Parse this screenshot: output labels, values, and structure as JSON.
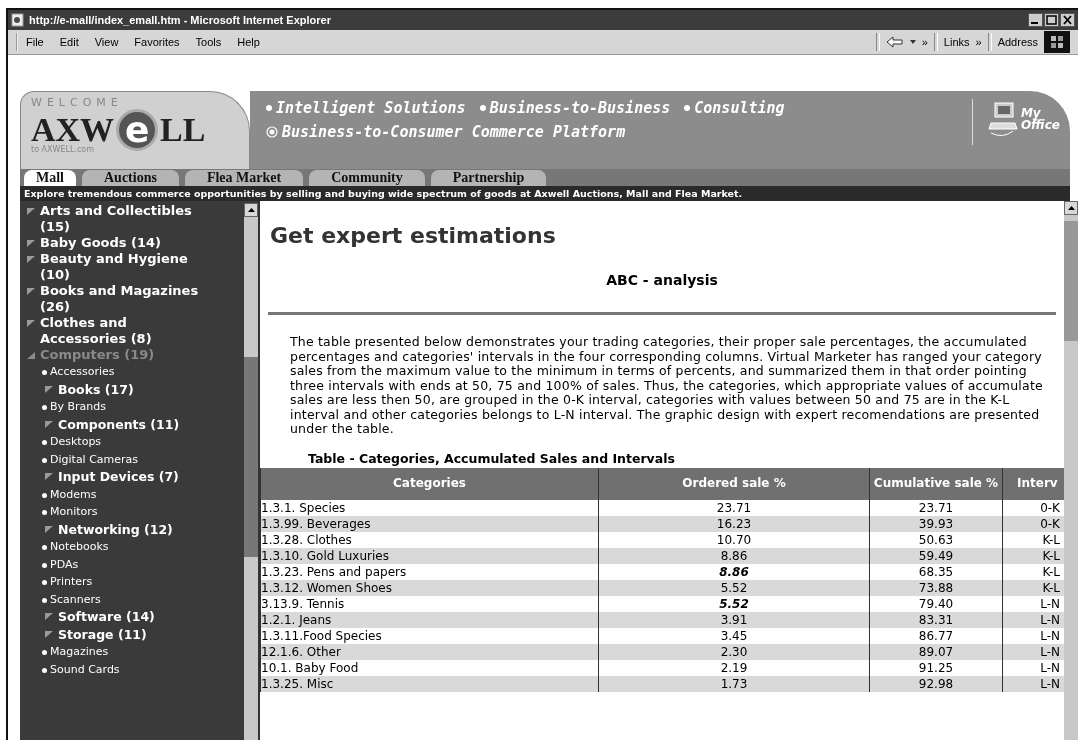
{
  "window": {
    "title": "http://e-mall/index_emall.htm - Microsoft Internet Explorer"
  },
  "menu": [
    "File",
    "Edit",
    "View",
    "Favorites",
    "Tools",
    "Help"
  ],
  "toolbar": {
    "more_1": "»",
    "links": "Links",
    "more_2": "»",
    "address": "Address"
  },
  "header": {
    "welcome": "WELCOME",
    "logo_left": "AXW",
    "logo_e": "e",
    "logo_right": "LL",
    "logo_sub": "to AXWELL.com",
    "taglines": [
      "Intelligent Solutions",
      "Business-to-Business",
      "Consulting"
    ],
    "platform": "Business-to-Consumer Commerce Platform",
    "office_1": "My",
    "office_2": "Office"
  },
  "tabs": [
    {
      "label": "Mall",
      "selected": true
    },
    {
      "label": "Auctions",
      "selected": false
    },
    {
      "label": "Flea Market",
      "selected": false
    },
    {
      "label": "Community",
      "selected": false
    },
    {
      "label": "Partnership",
      "selected": false
    }
  ],
  "banner": "Explore tremendous commerce opportunities by selling and buying wide spectrum of goods at Axwell Auctions, Mall and Flea Market.",
  "sidebar": {
    "items": [
      {
        "label": "Arts and Collectibles (15)",
        "kind": "category",
        "expanded": false
      },
      {
        "label": "Baby Goods (14)",
        "kind": "category",
        "expanded": false
      },
      {
        "label": "Beauty and Hygiene (10)",
        "kind": "category",
        "expanded": false
      },
      {
        "label": "Books and Magazines (26)",
        "kind": "category",
        "expanded": false
      },
      {
        "label": "Clothes and Accessories (8)",
        "kind": "category",
        "expanded": false
      },
      {
        "label": "Computers (19)",
        "kind": "category",
        "expanded": true,
        "children": [
          {
            "label": "Accessories",
            "kind": "link"
          },
          {
            "label": "Books (17)",
            "kind": "group"
          },
          {
            "label": "By Brands",
            "kind": "link"
          },
          {
            "label": "Components (11)",
            "kind": "group"
          },
          {
            "label": "Desktops",
            "kind": "link"
          },
          {
            "label": "Digital Cameras",
            "kind": "link"
          },
          {
            "label": "Input Devices (7)",
            "kind": "group"
          },
          {
            "label": "Modems",
            "kind": "link"
          },
          {
            "label": "Monitors",
            "kind": "link"
          },
          {
            "label": "Networking (12)",
            "kind": "group"
          },
          {
            "label": "Notebooks",
            "kind": "link"
          },
          {
            "label": "PDAs",
            "kind": "link"
          },
          {
            "label": "Printers",
            "kind": "link"
          },
          {
            "label": "Scanners",
            "kind": "link"
          },
          {
            "label": "Software (14)",
            "kind": "group"
          },
          {
            "label": "Storage (11)",
            "kind": "group"
          },
          {
            "label": "Magazines",
            "kind": "link"
          },
          {
            "label": "Sound Cards",
            "kind": "link"
          }
        ]
      }
    ]
  },
  "content": {
    "title": "Get expert estimations",
    "subtitle": "ABC - analysis",
    "paragraph": "The table presented below demonstrates your trading categories, their proper sale percentages, the accumulated percentages and categories' intervals in the four corresponding columns. Virtual Marketer has ranged your category sales from the maximum value to the minimum in terms of percents, and summarized them in that order pointing three intervals with ends at 50, 75 and 100% of sales. Thus, the categories, which appropriate values of accumulate sales are less then 50, are grouped in the 0-K interval, categories with values between 50 and 75 are in the K-L interval and other categories belongs to L-N interval. The graphic design with expert recomendations are presented under the table.",
    "table": {
      "caption": "Table - Categories, Accumulated Sales and Intervals",
      "columns": [
        "Categories",
        "Ordered sale %",
        "Cumulative sale %",
        "Interv"
      ],
      "rows": [
        {
          "cells": [
            "1.3.1. Species",
            "23.71",
            "23.71",
            "0-K"
          ],
          "emphasized": false
        },
        {
          "cells": [
            "1.3.99. Beverages",
            "16.23",
            "39.93",
            "0-K"
          ],
          "emphasized": false
        },
        {
          "cells": [
            "1.3.28. Clothes",
            "10.70",
            "50.63",
            "K-L"
          ],
          "emphasized": false
        },
        {
          "cells": [
            "1.3.10. Gold Luxuries",
            "8.86",
            "59.49",
            "K-L"
          ],
          "emphasized": false
        },
        {
          "cells": [
            "1.3.23. Pens and papers",
            "8.86",
            "68.35",
            "K-L"
          ],
          "emphasized": true
        },
        {
          "cells": [
            "1.3.12. Women Shoes",
            "5.52",
            "73.88",
            "K-L"
          ],
          "emphasized": false
        },
        {
          "cells": [
            "3.13.9. Tennis",
            "5.52",
            "79.40",
            "L-N"
          ],
          "emphasized": true
        },
        {
          "cells": [
            "1.2.1. Jeans",
            "3.91",
            "83.31",
            "L-N"
          ],
          "emphasized": false
        },
        {
          "cells": [
            "1.3.11.Food Species",
            "3.45",
            "86.77",
            "L-N"
          ],
          "emphasized": false
        },
        {
          "cells": [
            "12.1.6. Other",
            "2.30",
            "89.07",
            "L-N"
          ],
          "emphasized": false
        },
        {
          "cells": [
            "10.1. Baby Food",
            "2.19",
            "91.25",
            "L-N"
          ],
          "emphasized": false
        },
        {
          "cells": [
            "1.3.25. Misc",
            "1.73",
            "92.98",
            "L-N"
          ],
          "emphasized": false
        }
      ]
    }
  }
}
